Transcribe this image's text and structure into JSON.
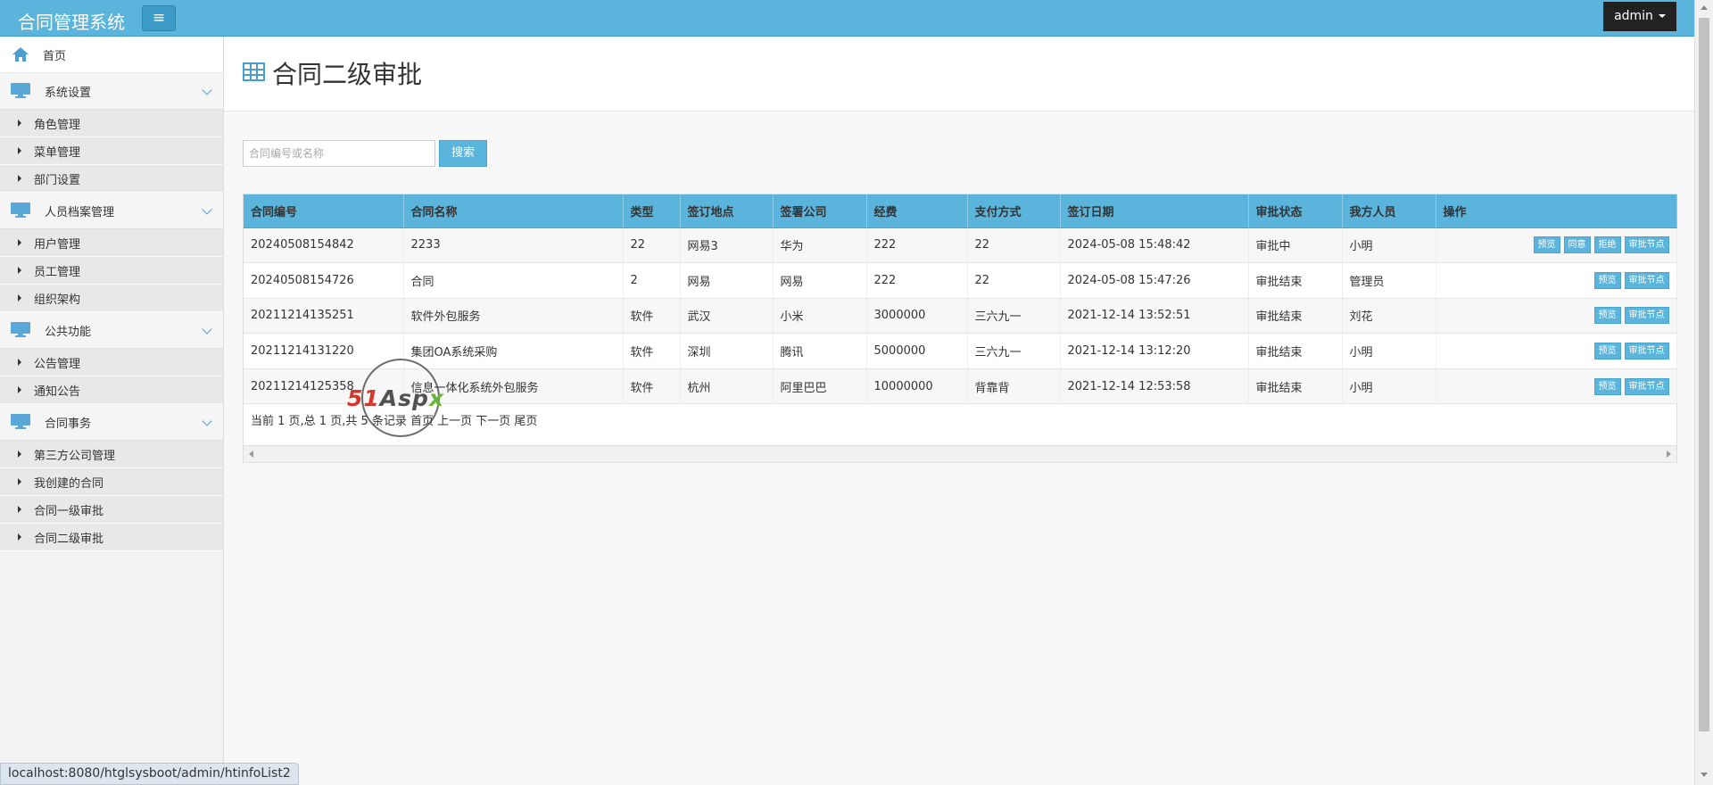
{
  "app": {
    "title": "合同管理系统",
    "menu_toggle_glyph": "≡",
    "user": "admin"
  },
  "sidebar": {
    "home": "首页",
    "groups": [
      {
        "label": "系统设置",
        "items": [
          "角色管理",
          "菜单管理",
          "部门设置"
        ]
      },
      {
        "label": "人员档案管理",
        "items": [
          "用户管理",
          "员工管理",
          "组织架构"
        ]
      },
      {
        "label": "公共功能",
        "items": [
          "公告管理",
          "通知公告"
        ]
      },
      {
        "label": "合同事务",
        "items": [
          "第三方公司管理",
          "我创建的合同",
          "合同一级审批",
          "合同二级审批"
        ]
      }
    ]
  },
  "page": {
    "title": "合同二级审批"
  },
  "search": {
    "placeholder": "合同编号或名称",
    "button": "搜索"
  },
  "table": {
    "columns": [
      "合同编号",
      "合同名称",
      "类型",
      "签订地点",
      "签署公司",
      "经费",
      "支付方式",
      "签订日期",
      "审批状态",
      "我方人员",
      "操作"
    ],
    "rows": [
      {
        "cells": [
          "20240508154842",
          "2233",
          "22",
          "网易3",
          "华为",
          "222",
          "22",
          "2024-05-08 15:48:42",
          "审批中",
          "小明"
        ],
        "actions": [
          "预览",
          "同意",
          "拒绝",
          "审批节点"
        ]
      },
      {
        "cells": [
          "20240508154726",
          "合同",
          "2",
          "网易",
          "网易",
          "222",
          "22",
          "2024-05-08 15:47:26",
          "审批结束",
          "管理员"
        ],
        "actions": [
          "预览",
          "审批节点"
        ]
      },
      {
        "cells": [
          "20211214135251",
          "软件外包服务",
          "软件",
          "武汉",
          "小米",
          "3000000",
          "三六九一",
          "2021-12-14 13:52:51",
          "审批结束",
          "刘花"
        ],
        "actions": [
          "预览",
          "审批节点"
        ]
      },
      {
        "cells": [
          "20211214131220",
          "集团OA系统采购",
          "软件",
          "深圳",
          "腾讯",
          "5000000",
          "三六九一",
          "2021-12-14 13:12:20",
          "审批结束",
          "小明"
        ],
        "actions": [
          "预览",
          "审批节点"
        ]
      },
      {
        "cells": [
          "20211214125358",
          "信息一体化系统外包服务",
          "软件",
          "杭州",
          "阿里巴巴",
          "10000000",
          "背靠背",
          "2021-12-14 12:53:58",
          "审批结束",
          "小明"
        ],
        "actions": [
          "预览",
          "审批节点"
        ]
      }
    ],
    "pager": "当前 1 页,总 1 页,共 5 条记录 首页 上一页 下一页 尾页"
  },
  "watermark": {
    "part1": "51",
    "part2": "Asp",
    "part3": "x"
  },
  "status_url": "localhost:8080/htglsysboot/admin/htinfoList2",
  "colors": {
    "accent": "#5ab4dc",
    "accent_dark": "#3d9cc7",
    "admin_bg": "#222222"
  }
}
